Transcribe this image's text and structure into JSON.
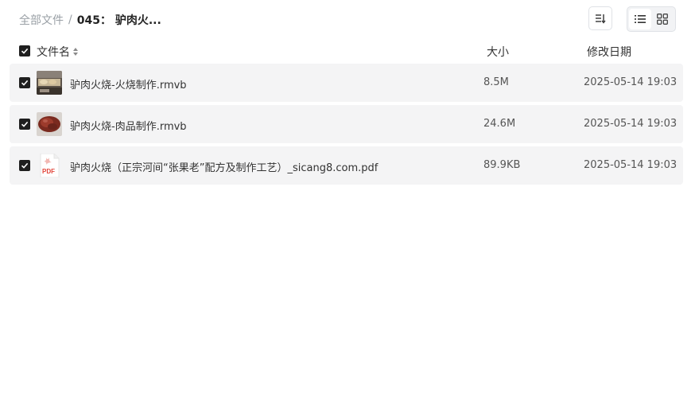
{
  "breadcrumb": {
    "root": "全部文件",
    "separator": "/",
    "current": "045： 驴肉火..."
  },
  "toolbar": {
    "sort_icon": "sort-icon",
    "list_view_icon": "list-view-icon",
    "grid_view_icon": "grid-view-icon"
  },
  "table": {
    "columns": {
      "name": "文件名",
      "size": "大小",
      "date": "修改日期"
    },
    "rows": [
      {
        "name": "驴肉火烧-火烧制作.rmvb",
        "size": "8.5M",
        "date": "2025-05-14 19:03",
        "thumb": "video-thumbnail-baking"
      },
      {
        "name": "驴肉火烧-肉品制作.rmvb",
        "size": "24.6M",
        "date": "2025-05-14 19:03",
        "thumb": "video-thumbnail-meat"
      },
      {
        "name": "驴肉火烧（正宗河间“张果老”配方及制作工艺）_sicang8.com.pdf",
        "size": "89.9KB",
        "date": "2025-05-14 19:03",
        "thumb": "pdf-file-icon",
        "thumb_label": "PDF"
      }
    ]
  },
  "colors": {
    "row_background": "#f4f4f5",
    "checkbox": "#1f1f1f",
    "pdf_red": "#e2463b"
  }
}
